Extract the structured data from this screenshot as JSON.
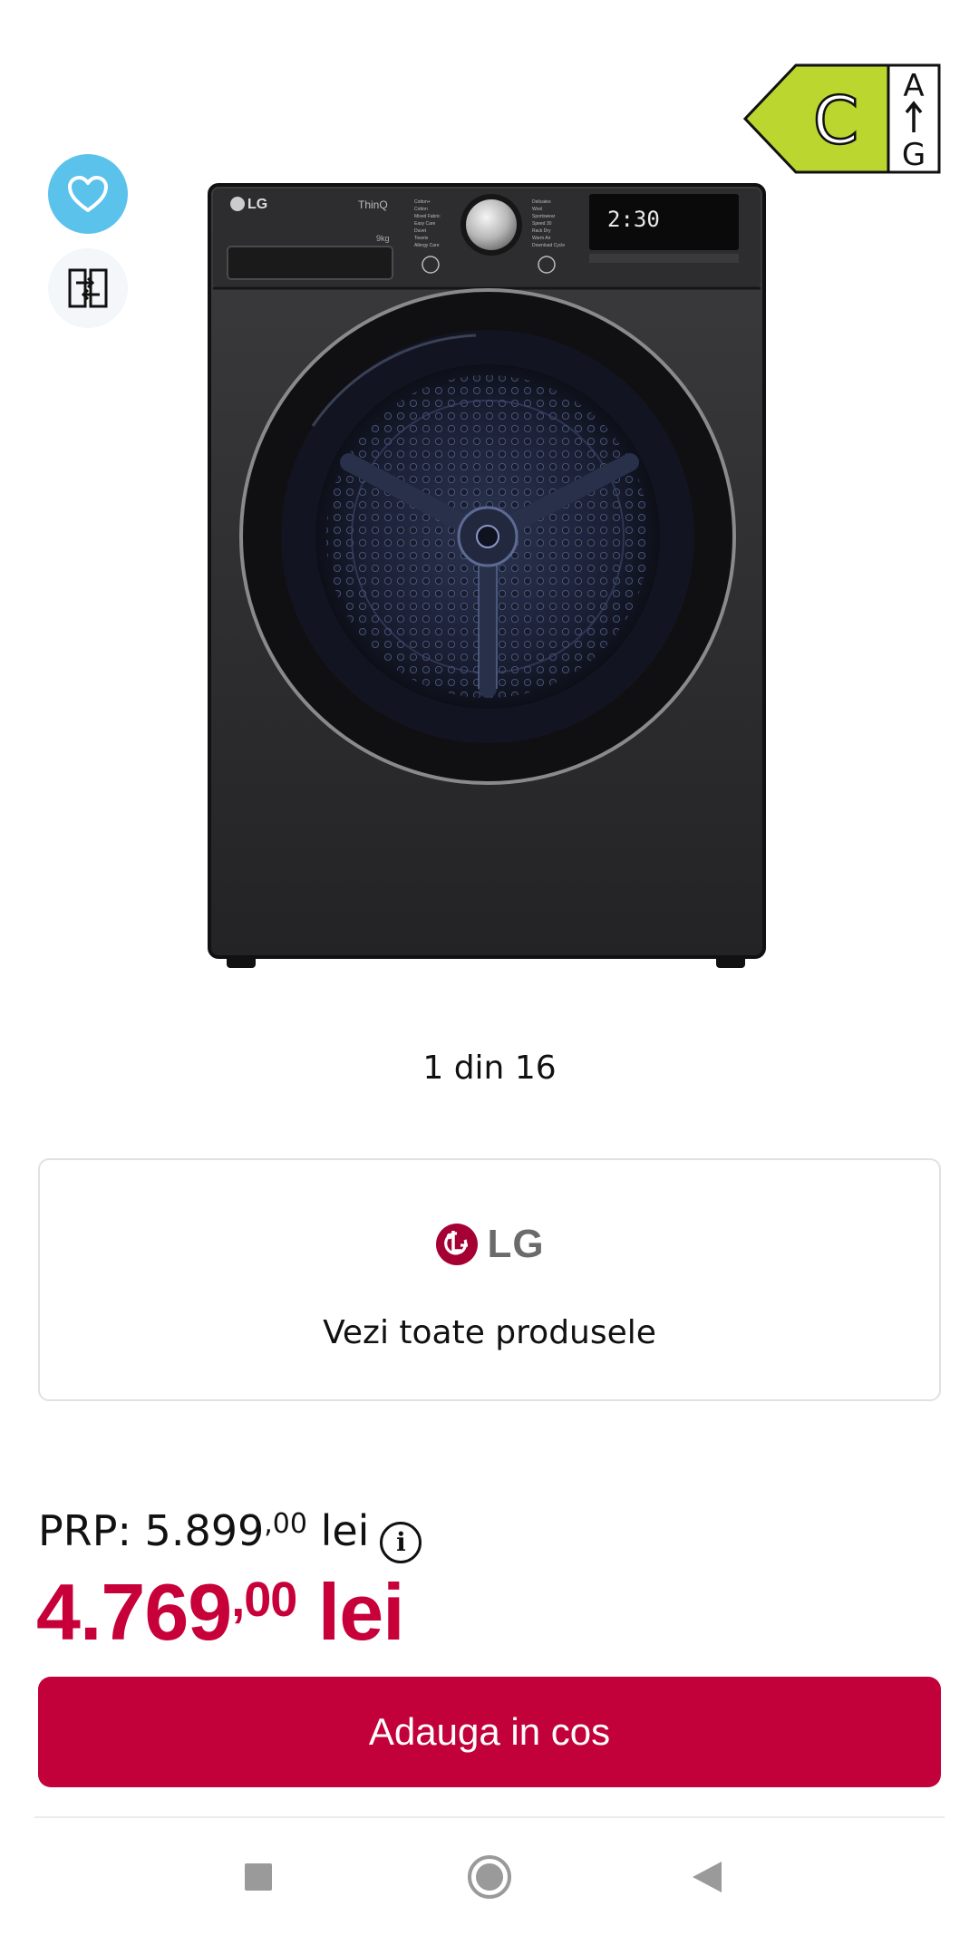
{
  "product": {
    "brand": "LG",
    "image_alt": "LG ThinQ dryer, black",
    "device_text": {
      "brand_mark": "LG",
      "series": "ThinQ",
      "capacity": "9kg",
      "display_time": "2:30"
    }
  },
  "energy_label": {
    "class": "C",
    "scale_top": "A",
    "scale_bottom": "G",
    "color": "#bcd630"
  },
  "gallery": {
    "pager": "1 din 16"
  },
  "brand_card": {
    "logo_text": "LG",
    "link_label": "Vezi toate produsele"
  },
  "pricing": {
    "prp_label": "PRP: 5.899",
    "prp_cents": ",00",
    "prp_currency": " lei",
    "info_symbol": "i",
    "price_main": "4.769",
    "price_cents": ",00",
    "price_currency": " lei",
    "price_color": "#c8003a"
  },
  "actions": {
    "add_to_cart": "Adauga in cos"
  },
  "icons": {
    "favorite": "heart-icon",
    "compare": "compare-icon",
    "info": "info-icon",
    "nav_recents": "square-icon",
    "nav_home": "circle-icon",
    "nav_back": "triangle-back-icon"
  }
}
